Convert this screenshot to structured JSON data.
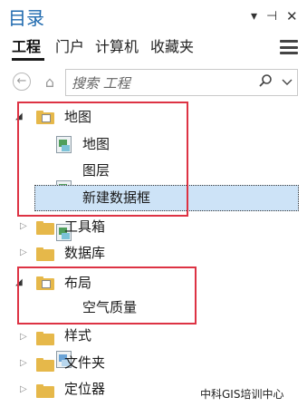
{
  "header": {
    "title": "目录",
    "dropdown_glyph": "▾",
    "pin_glyph": "⊣",
    "close_glyph": "✕"
  },
  "tabs": [
    {
      "label": "工程",
      "active": true
    },
    {
      "label": "门户",
      "active": false
    },
    {
      "label": "计算机",
      "active": false
    },
    {
      "label": "收藏夹",
      "active": false
    }
  ],
  "toolbar": {
    "back_glyph": "←",
    "home_glyph": "⌂"
  },
  "search": {
    "placeholder": "搜索 工程",
    "icon": "search-icon",
    "dropdown": "chevron-down-icon"
  },
  "tree": {
    "maps": {
      "label": "地图",
      "expanded": true,
      "children": [
        {
          "label": "地图"
        },
        {
          "label": "图层"
        },
        {
          "label": "新建数据框",
          "selected": true
        }
      ]
    },
    "toolboxes": {
      "label": "工具箱",
      "expanded": false
    },
    "databases": {
      "label": "数据库",
      "expanded": false
    },
    "layouts": {
      "label": "布局",
      "expanded": true,
      "children": [
        {
          "label": "空气质量"
        }
      ]
    },
    "styles": {
      "label": "样式",
      "expanded": false
    },
    "folders": {
      "label": "文件夹",
      "expanded": false
    },
    "locators": {
      "label": "定位器",
      "expanded": false
    }
  },
  "colors": {
    "title": "#1e69ae",
    "selection": "#cde3f7",
    "highlight_box": "#dd3344",
    "folder": "#e6b84a"
  },
  "watermark": "中科GIS培训中心"
}
